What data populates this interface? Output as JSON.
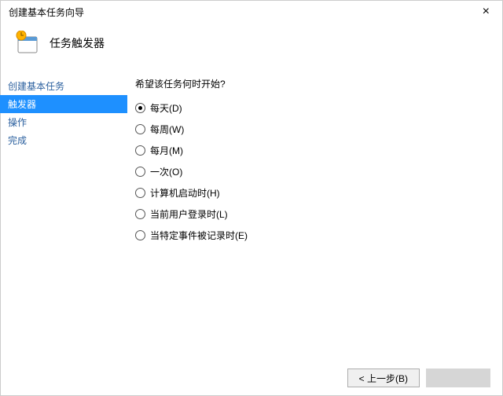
{
  "window": {
    "title": "创建基本任务向导"
  },
  "header": {
    "title": "任务触发器"
  },
  "sidebar": {
    "items": [
      {
        "label": "创建基本任务",
        "active": false
      },
      {
        "label": "触发器",
        "active": true
      },
      {
        "label": "操作",
        "active": false
      },
      {
        "label": "完成",
        "active": false
      }
    ]
  },
  "content": {
    "prompt": "希望该任务何时开始?",
    "options": [
      {
        "label": "每天(D)",
        "selected": true
      },
      {
        "label": "每周(W)",
        "selected": false
      },
      {
        "label": "每月(M)",
        "selected": false
      },
      {
        "label": "一次(O)",
        "selected": false
      },
      {
        "label": "计算机启动时(H)",
        "selected": false
      },
      {
        "label": "当前用户登录时(L)",
        "selected": false
      },
      {
        "label": "当特定事件被记录时(E)",
        "selected": false
      }
    ]
  },
  "footer": {
    "back": "< 上一步(B)"
  }
}
